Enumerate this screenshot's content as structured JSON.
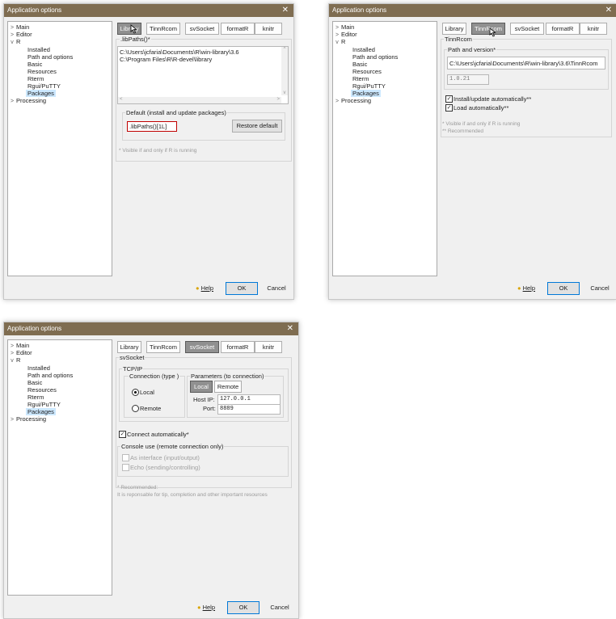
{
  "title": "Application options",
  "close_glyph": "✕",
  "tree": {
    "main": "Main",
    "editor": "Editor",
    "r": "R",
    "installed": "Installed",
    "path_options": "Path and options",
    "basic": "Basic",
    "resources": "Resources",
    "rterm": "Rterm",
    "rgui": "Rgui/PuTTY",
    "packages": "Packages",
    "processing": "Processing"
  },
  "tabs": {
    "library": "Library",
    "tinnrcom": "TinnRcom",
    "svsocket": "svSocket",
    "formatr": "formatR",
    "knitr": "knitr"
  },
  "buttons": {
    "help": "Help",
    "ok": "OK",
    "cancel": "Cancel"
  },
  "library_panel": {
    "group": ".libPaths()*",
    "paths": [
      "C:\\Users\\jcfaria\\Documents\\R\\win-library\\3.6",
      "C:\\Program Files\\R\\R-devel\\library"
    ],
    "default_group": "Default (install and update packages)",
    "default_value": ".libPaths()[1L]",
    "restore_button": "Restore default",
    "note": "* Visible if and only if R is running"
  },
  "tinnrcom_panel": {
    "group": "TinnRcom",
    "path_group": "Path and version*",
    "path": "C:\\Users\\jcfaria\\Documents\\R\\win-library\\3.6\\TinnRcom",
    "version": "1.0.21",
    "install_auto": "Install/update automatically**",
    "load_auto": "Load automatically**",
    "note1": "*  Visible if and only if R is running",
    "note2": "** Recommended"
  },
  "svsocket_panel": {
    "group": "svSocket",
    "tcpip": "TCP/IP",
    "connection_type": "Connection (type )",
    "local": "Local",
    "remote": "Remote",
    "params": "Parameters (to connection)",
    "param_tab_local": "Local",
    "param_tab_remote": "Remote",
    "host_label": "Host IP:",
    "host_value": "127.0.0.1",
    "port_label": "Port:",
    "port_value": "8889",
    "connect_auto": "Connect automatically*",
    "console_group": "Console use (remote connection only)",
    "as_interface": "As interface (input/output)",
    "echo": "Echo (sending/controlling)",
    "note1": "* Recommended:",
    "note2": "  It is reponsable for tip, completion and other important resources"
  },
  "colors": {
    "titlebar": "#7f6d51",
    "selection": "#cce8ff",
    "active_tab": "#909090",
    "ok_border": "#0078d7"
  }
}
